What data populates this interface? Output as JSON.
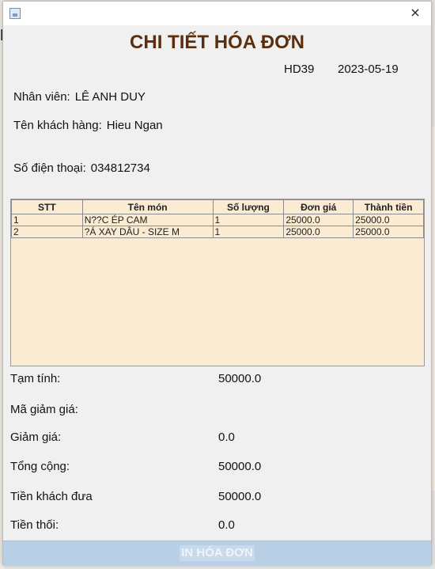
{
  "background": {
    "edge_letter": "M"
  },
  "window": {
    "close_glyph": "×"
  },
  "invoice": {
    "title": "CHI TIẾT HÓA ĐƠN",
    "id": "HD39",
    "date": "2023-05-19",
    "employee_label": "Nhân viên:",
    "employee_value": "LÊ ANH DUY",
    "customer_label": "Tên khách hàng:",
    "customer_value": "Hieu Ngan",
    "phone_label": "Số điện thoại:",
    "phone_value": "034812734"
  },
  "table": {
    "columns": [
      "STT",
      "Tên món",
      "Số lượng",
      "Đơn giá",
      "Thành tiền"
    ],
    "rows": [
      [
        "1",
        "N??C ÉP CAM",
        "1",
        "25000.0",
        "25000.0"
      ],
      [
        "2",
        "?Á XAY DÂU - SIZE M",
        "1",
        "25000.0",
        "25000.0"
      ]
    ]
  },
  "summary": {
    "subtotal_label": "Tạm tính:",
    "subtotal_value": "50000.0",
    "discount_code_label": "Mã giảm giá:",
    "discount_code_value": "",
    "discount_label": "Giảm giá:",
    "discount_value": "0.0",
    "total_label": "Tổng cộng:",
    "total_value": "50000.0",
    "paid_label": "Tiền khách đưa",
    "paid_value": "50000.0",
    "change_label": "Tiền thối:",
    "change_value": "0.0"
  },
  "actions": {
    "print_label": "IN HÓA ĐƠN"
  },
  "colors": {
    "title": "#5a2e0e",
    "table_bg": "#fbebd3",
    "button_bg": "#b9cfe6"
  }
}
